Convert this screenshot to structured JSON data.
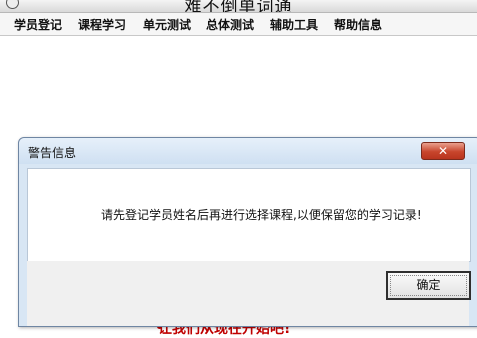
{
  "window": {
    "title": "难不倒单词通"
  },
  "menu": {
    "items": [
      "学员登记",
      "课程学习",
      "单元测试",
      "总体测试",
      "辅助工具",
      "帮助信息"
    ]
  },
  "background": {
    "bottom_text": "让我们从现在开始吧!"
  },
  "dialog": {
    "title": "警告信息",
    "close_symbol": "✕",
    "message": "请先登记学员姓名后再进行选择课程,以便保留您的学习记录!",
    "ok_label": "确定"
  }
}
